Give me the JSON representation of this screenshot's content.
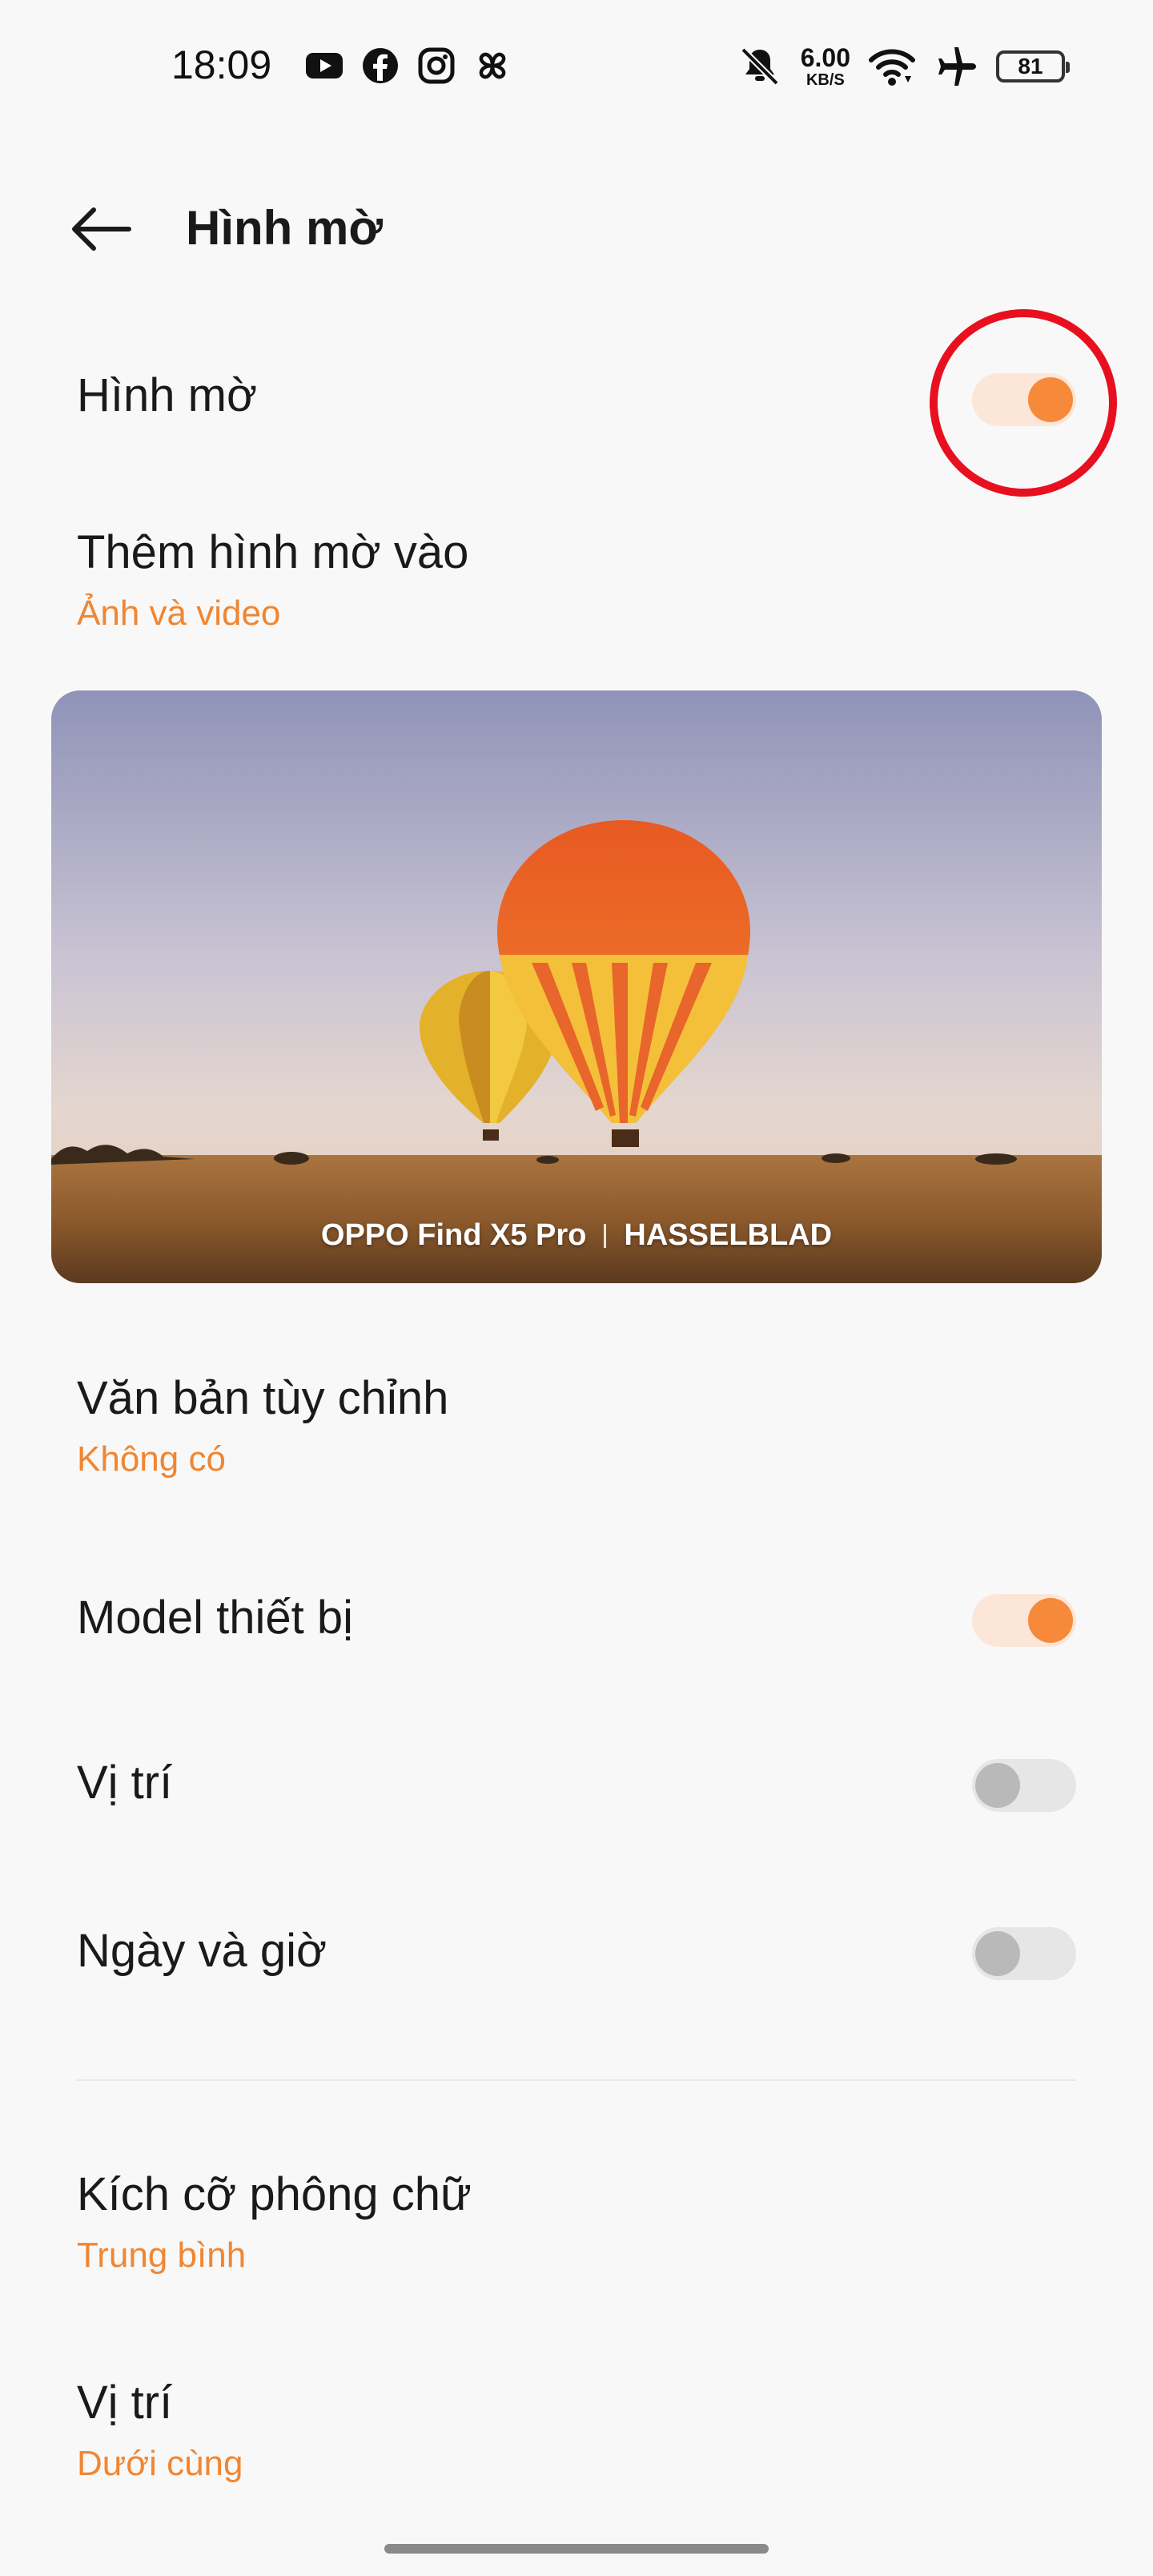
{
  "status_bar": {
    "time": "18:09",
    "network_speed_value": "6.00",
    "network_speed_unit": "KB/S",
    "battery_level": "81",
    "app_icons": [
      "youtube-icon",
      "facebook-icon",
      "instagram-icon",
      "pinwheel-icon"
    ],
    "right_icons": [
      "notifications-muted-icon",
      "wifi-icon",
      "airplane-mode-icon",
      "battery-icon"
    ]
  },
  "header": {
    "title": "Hình mờ",
    "back_icon": "back-arrow-icon"
  },
  "settings": {
    "watermark_toggle": {
      "label": "Hình mờ",
      "enabled": true
    },
    "add_watermark_to": {
      "label": "Thêm hình mờ vào",
      "value": "Ảnh và video"
    },
    "preview": {
      "brand_text": "OPPO Find X5 Pro",
      "partner_text": "HASSELBLAD"
    },
    "custom_text": {
      "label": "Văn bản tùy chỉnh",
      "value": "Không có"
    },
    "device_model": {
      "label": "Model thiết bị",
      "enabled": true
    },
    "location": {
      "label": "Vị trí",
      "enabled": false
    },
    "date_time": {
      "label": "Ngày và giờ",
      "enabled": false
    },
    "font_size": {
      "label": "Kích cỡ phông chữ",
      "value": "Trung bình"
    },
    "position": {
      "label": "Vị trí",
      "value": "Dưới cùng"
    }
  },
  "colors": {
    "accent": "#f7893a",
    "highlight_annotation": "#e8101f"
  }
}
